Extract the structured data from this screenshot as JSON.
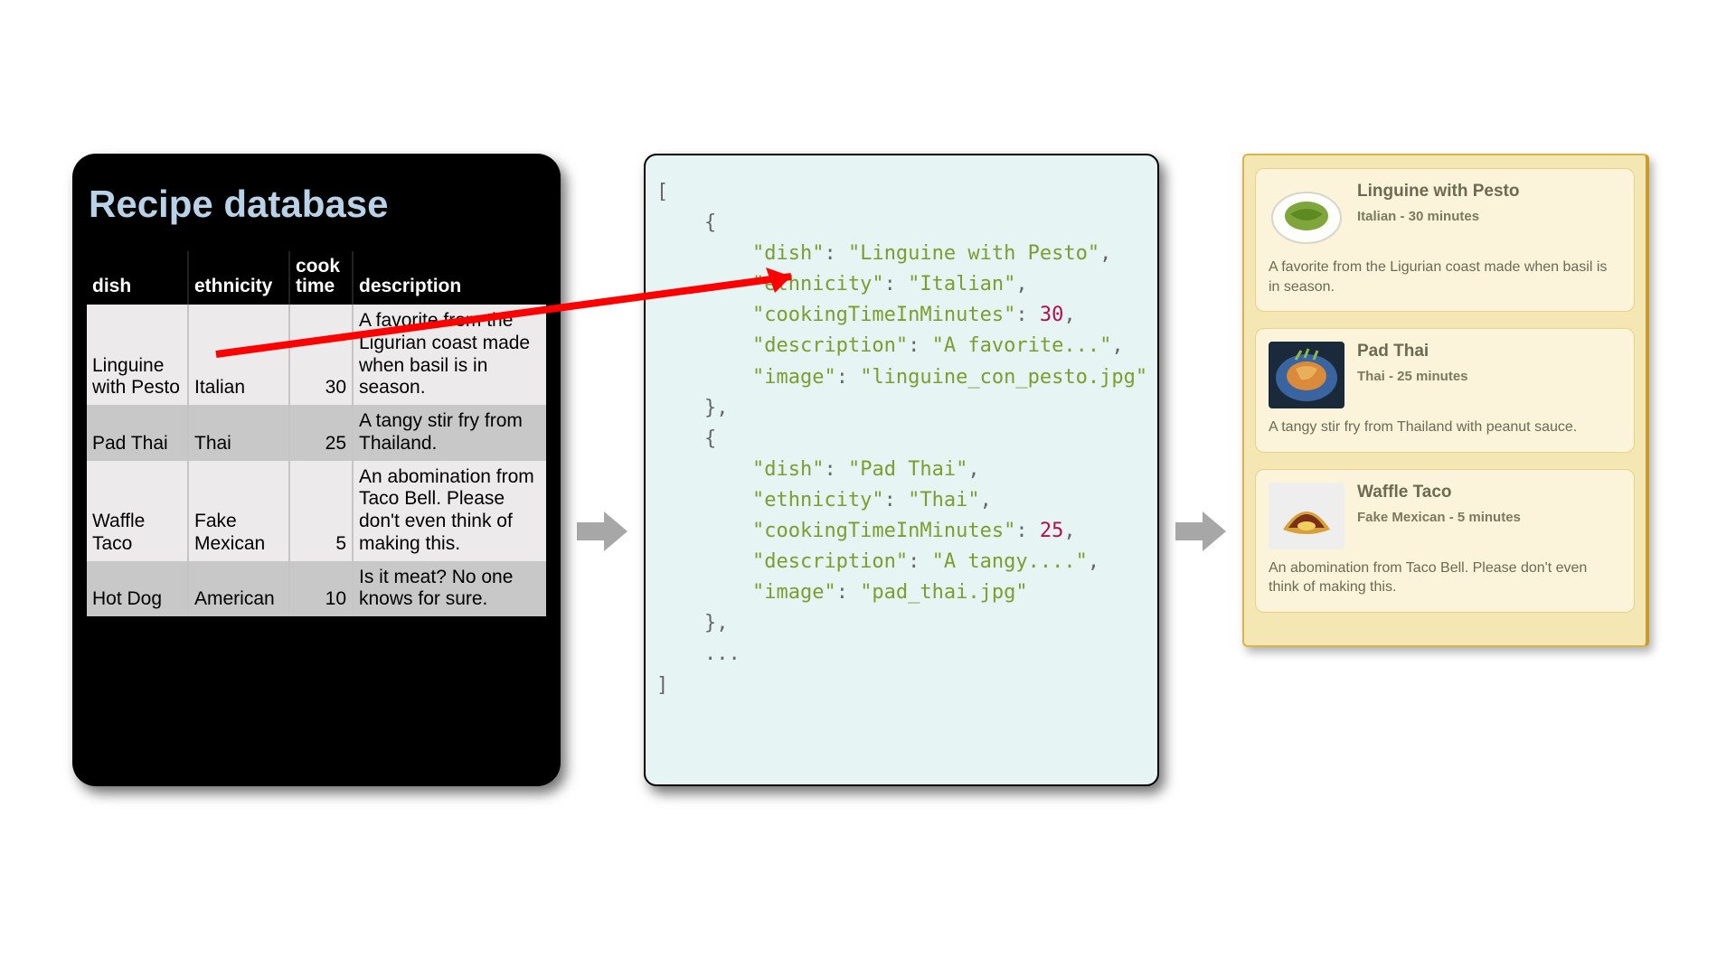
{
  "db": {
    "title": "Recipe database",
    "columns": {
      "dish": "dish",
      "ethnicity": "ethnicity",
      "time": "cook time",
      "description": "description"
    },
    "rows": [
      {
        "dish": "Linguine with Pesto",
        "ethnicity": "Italian",
        "time": "30",
        "description": "A favorite from the Ligurian coast made when basil is in season."
      },
      {
        "dish": "Pad Thai",
        "ethnicity": "Thai",
        "time": "25",
        "description": "A tangy stir fry from Thailand."
      },
      {
        "dish": "Waffle Taco",
        "ethnicity": "Fake Mexican",
        "time": "5",
        "description": "An abomination from Taco Bell. Please don't even think of making this."
      },
      {
        "dish": "Hot Dog",
        "ethnicity": "American",
        "time": "10",
        "description": "Is it meat? No one knows for sure."
      }
    ]
  },
  "json_code": {
    "lines": [
      {
        "t": "[",
        "cls": "punc"
      },
      {
        "t": "    {",
        "cls": "punc"
      },
      {
        "kv": true,
        "key": "dish",
        "valType": "str",
        "val": "Linguine with Pesto",
        "comma": true
      },
      {
        "kv": true,
        "key": "ethnicity",
        "valType": "str",
        "val": "Italian",
        "comma": true
      },
      {
        "kv": true,
        "key": "cookingTimeInMinutes",
        "valType": "num",
        "val": "30",
        "comma": true
      },
      {
        "kv": true,
        "key": "description",
        "valType": "str",
        "val": "A favorite...",
        "comma": true
      },
      {
        "kv": true,
        "key": "image",
        "valType": "str",
        "val": "linguine_con_pesto.jpg",
        "comma": false
      },
      {
        "t": "    },",
        "cls": "punc"
      },
      {
        "t": "    {",
        "cls": "punc"
      },
      {
        "kv": true,
        "key": "dish",
        "valType": "str",
        "val": "Pad Thai",
        "comma": true
      },
      {
        "kv": true,
        "key": "ethnicity",
        "valType": "str",
        "val": "Thai",
        "comma": true
      },
      {
        "kv": true,
        "key": "cookingTimeInMinutes",
        "valType": "num",
        "val": "25",
        "comma": true
      },
      {
        "kv": true,
        "key": "description",
        "valType": "str",
        "val": "A tangy....",
        "comma": true
      },
      {
        "kv": true,
        "key": "image",
        "valType": "str",
        "val": "pad_thai.jpg",
        "comma": false
      },
      {
        "t": "    },",
        "cls": "punc"
      },
      {
        "t": "    ...",
        "cls": "punc"
      },
      {
        "t": "]",
        "cls": "punc"
      }
    ]
  },
  "cards": [
    {
      "title": "Linguine with Pesto",
      "meta": "Italian - 30 minutes",
      "desc": "A favorite from the Ligurian coast made when basil is in season.",
      "icon": "pesto"
    },
    {
      "title": "Pad Thai",
      "meta": "Thai - 25 minutes",
      "desc": "A tangy stir fry from Thailand with peanut sauce.",
      "icon": "padthai"
    },
    {
      "title": "Waffle Taco",
      "meta": "Fake Mexican - 5 minutes",
      "desc": "An abomination from Taco Bell. Please don't even think of making this.",
      "icon": "taco"
    }
  ]
}
